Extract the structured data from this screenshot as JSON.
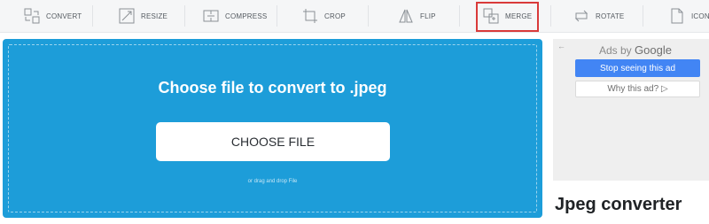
{
  "toolbar": {
    "items": [
      {
        "label": "CONVERT",
        "icon": "convert-icon"
      },
      {
        "label": "RESIZE",
        "icon": "resize-icon"
      },
      {
        "label": "COMPRESS",
        "icon": "compress-icon"
      },
      {
        "label": "CROP",
        "icon": "crop-icon"
      },
      {
        "label": "FLIP",
        "icon": "flip-icon"
      },
      {
        "label": "MERGE",
        "icon": "merge-icon"
      },
      {
        "label": "ROTATE",
        "icon": "rotate-icon"
      },
      {
        "label": "ICON",
        "icon": "ico-file-icon"
      }
    ],
    "highlighted": "MERGE",
    "highlight_color": "#d93a3a"
  },
  "upload": {
    "title": "Choose file to convert to .jpeg",
    "button_label": "CHOOSE FILE",
    "hint": "or drag and drop File",
    "background_color": "#1d9dd9"
  },
  "ad": {
    "back_symbol": "←",
    "ads_by_prefix": "Ads by",
    "ads_by_brand": "Google",
    "stop_label": "Stop seeing this ad",
    "why_label": "Why this ad? ▷"
  },
  "sidebar": {
    "heading": "Jpeg converter"
  }
}
